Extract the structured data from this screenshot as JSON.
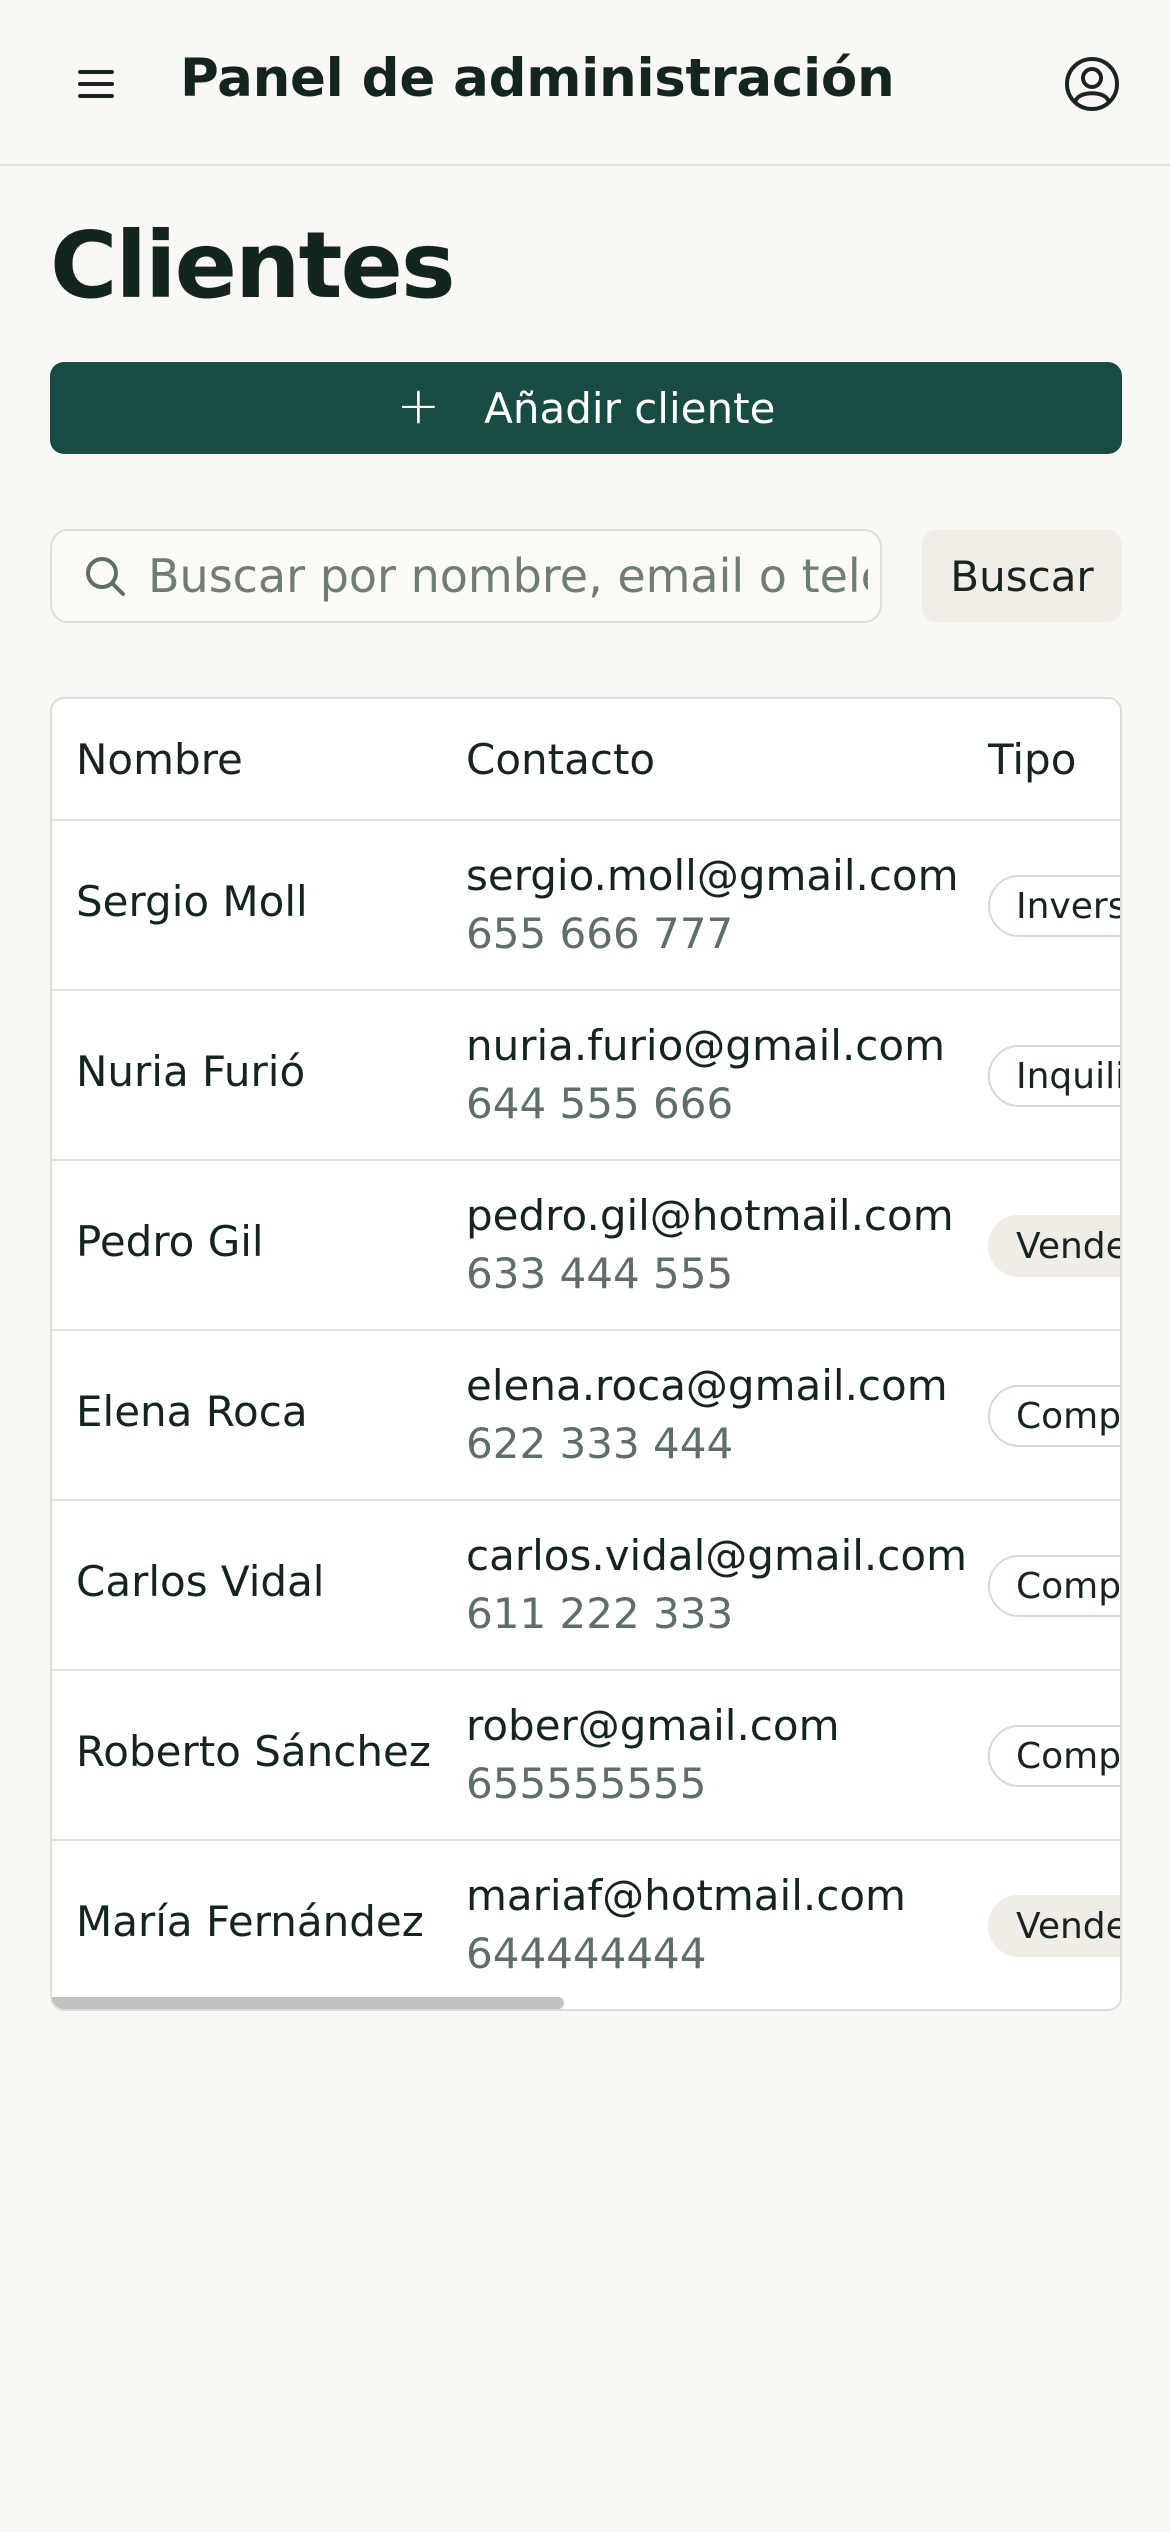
{
  "header": {
    "title": "Panel de administración",
    "menu_icon": "menu-icon",
    "account_icon": "user-circle-icon"
  },
  "page": {
    "title": "Clientes",
    "add_button_label": "Añadir cliente"
  },
  "search": {
    "placeholder": "Buscar por nombre, email o teléfono",
    "value": "",
    "button_label": "Buscar"
  },
  "table": {
    "columns": [
      "Nombre",
      "Contacto",
      "Tipo"
    ],
    "rows": [
      {
        "name": "Sergio Moll",
        "email": "sergio.moll@gmail.com",
        "phone": "655 666 777",
        "type": "Inversor",
        "type_style": "outline"
      },
      {
        "name": "Nuria Furió",
        "email": "nuria.furio@gmail.com",
        "phone": "644 555 666",
        "type": "Inquilino",
        "type_style": "outline"
      },
      {
        "name": "Pedro Gil",
        "email": "pedro.gil@hotmail.com",
        "phone": "633 444 555",
        "type": "Vendedor",
        "type_style": "filled"
      },
      {
        "name": "Elena Roca",
        "email": "elena.roca@gmail.com",
        "phone": "622 333 444",
        "type": "Comprador",
        "type_style": "outline"
      },
      {
        "name": "Carlos Vidal",
        "email": "carlos.vidal@gmail.com",
        "phone": "611 222 333",
        "type": "Comprador",
        "type_style": "outline"
      },
      {
        "name": "Roberto Sánchez",
        "email": "rober@gmail.com",
        "phone": "655555555",
        "type": "Comprador",
        "type_style": "outline"
      },
      {
        "name": "María Fernández",
        "email": "mariaf@hotmail.com",
        "phone": "644444444",
        "type": "Vendedor",
        "type_style": "filled"
      }
    ]
  },
  "colors": {
    "background": "#f9f8f5",
    "primary": "#184c43",
    "text": "#17241f",
    "muted_text": "#5e6e68",
    "border": "#dedcd6",
    "badge_filled": "#efede5"
  }
}
